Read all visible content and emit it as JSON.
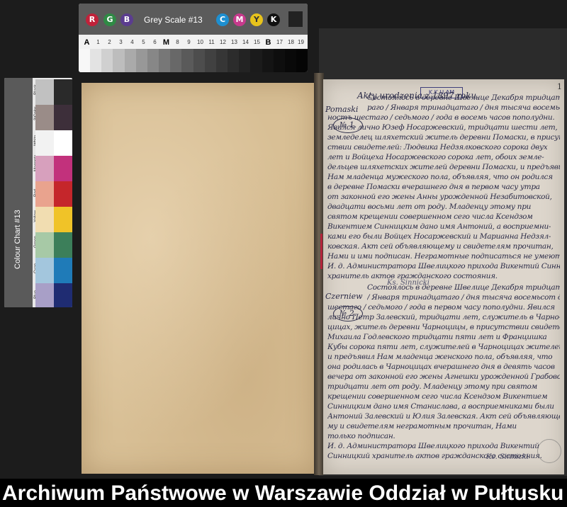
{
  "grey_scale_card": {
    "letters": [
      "R",
      "G",
      "B",
      "C",
      "M",
      "Y",
      "K"
    ],
    "title": "Grey Scale #13",
    "scale_labels": [
      "A",
      "1",
      "2",
      "3",
      "4",
      "5",
      "6",
      "M",
      "8",
      "9",
      "10",
      "11",
      "12",
      "13",
      "14",
      "15",
      "B",
      "17",
      "18",
      "19"
    ]
  },
  "colour_chart": {
    "title": "Colour Chart #13",
    "labels": [
      "Blue",
      "Cyan",
      "Green",
      "Yellow",
      "Red",
      "Magenta",
      "White",
      "3/Color",
      "Black"
    ],
    "swatch_colors": {
      "left": [
        "#c1c1c1",
        "#9a8c88",
        "#f2f2f2",
        "#d7a0bd",
        "#e9a38e",
        "#f1ddb1",
        "#a7c9a6",
        "#a3c6dd",
        "#a89fc7"
      ],
      "right": [
        "#2a2a2a",
        "#3d2f3a",
        "#ffffff",
        "#c2317c",
        "#c5262b",
        "#f0c328",
        "#3c7f5a",
        "#1f7bb8",
        "#1f2c72"
      ]
    }
  },
  "document": {
    "page_number": "1",
    "stamp": "K.K.U.AM",
    "header": "Akty urodzenia z 1897 roku.",
    "margin_labels": [
      "Pomaski",
      "Czerniew"
    ],
    "act_numbers": [
      "№ 1.",
      "№ 2."
    ],
    "lines_act1": [
      "Состоялось в деревне Швелице Декабря тридцать вто-",
      "раго / Января тринадцатаго / дня тысяча восемьсот девя-",
      "ностъ шестаго / седьмого / года в восемь часов пополудни.",
      "Явился лично Юзеф Носаржевский, тридцати шести лет,",
      "земледелец шляхетский житель деревни Помаски, в присут-",
      "ствии свидетелей: Людвика Недзялковского сорока двух",
      "лет и Войцеха Носаржевского сорока лет, обоих земле-",
      "дельцев шляхетских жителей деревни Помаски, и предъявил",
      "Нам младенца мужеского пола, объявляя, что он родился",
      "в деревне Помаски вчерашнего дня в первом часу утра",
      "от законной его жены Анны урожденной Незабитовской,",
      "двадцати восьми лет от роду. Младенцу этому при",
      "святом крещении совершенном сего числа Ксендзом",
      "Викентием Синницким дано имя Антоний, а восприемни-",
      "ками его были Войцех Носаржевский и Марианна Недзял-",
      "ковская. Акт сей объявляющему и свидетелям прочитан,",
      "Нами и ими подписан. Неграмотные подписаться не умеют.",
      "И. д. Администратора Швелицкого прихода Викентий Синницкий",
      "хранитель актов гражданского состояния."
    ],
    "sign_act1": "Ks. Sinnicki",
    "lines_act2": [
      "Состоялось в деревне Швелице Декабря тридцать второго",
      "/ Января тринадцатаго / дня тысяча восемьсот девяносто",
      "шестаго / седьмого / года в первом часу пополудни. Явился",
      "лично Петр Залевский, тридцати лет, служитель в Чарно-",
      "цицах, житель деревни Чарноцицы, в присутствии свидетелей:",
      "Михаила Годлевского тридцати пяти лет и Францишка",
      "Кубы сорока пяти лет, служителей в Чарноцицах жителей,",
      "и предъявил Нам младенца женского пола, объявляя, что",
      "она родилась в Чарноцицах вчерашнего дня в девять часов",
      "вечера от законной его жены Агнешки урожденной Грабовской,",
      "тридцати лет от роду. Младенцу этому при святом",
      "крещении совершенном сего числа Ксендзом Викентием",
      "Синницким дано имя Станислава, а восприемниками были",
      "Антоний Залевский и Юлия Залевская. Акт сей объявляюще-",
      "му и свидетелям неграмотным прочитан, Нами",
      "только подписан.",
      "И. д. Администратора Швелицкого прихода Викентий",
      "Синницкий хранитель актов гражданского состояния."
    ],
    "sign_act2": "Ks. Sinnicki"
  },
  "footer": {
    "text": "Archiwum Państwowe w Warszawie Oddział w Pułtusku"
  }
}
